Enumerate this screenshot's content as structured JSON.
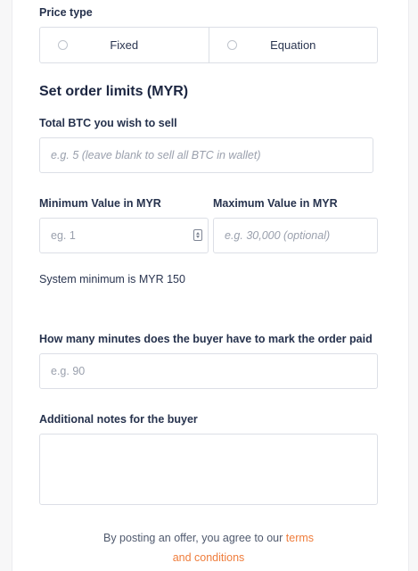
{
  "price_type": {
    "label": "Price type",
    "options": [
      "Fixed",
      "Equation"
    ]
  },
  "order_limits": {
    "title": "Set order limits (MYR)",
    "total_btc_label": "Total BTC you wish to sell",
    "total_btc_placeholder": "e.g. 5 (leave blank to sell all BTC in wallet)",
    "min_label": "Minimum Value in MYR",
    "min_placeholder": "eg. 1",
    "max_label": "Maximum Value in MYR",
    "max_placeholder": "e.g. 30,000 (optional)",
    "system_minimum": "System minimum is MYR 150"
  },
  "payment_window": {
    "label": "How many minutes does the buyer have to mark the order paid",
    "placeholder": "e.g. 90"
  },
  "notes": {
    "label": "Additional notes for the buyer",
    "value": ""
  },
  "footer": {
    "text": "By posting an offer, you agree to our",
    "link": "terms",
    "second_line": "and conditions"
  },
  "colors": {
    "link": "#ef7d3c",
    "border": "#dcdfe6"
  },
  "icons": [
    "radio-icon",
    "number-stepper-icon"
  ]
}
